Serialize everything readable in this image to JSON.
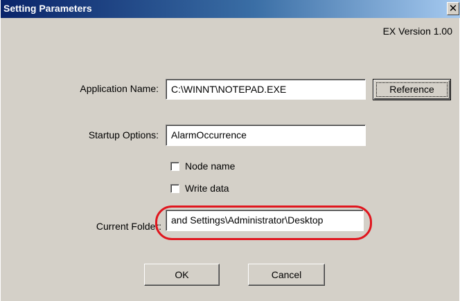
{
  "window": {
    "title": "Setting Parameters",
    "close_glyph": "✕",
    "version": "EX Version 1.00"
  },
  "form": {
    "application_name": {
      "label": "Application Name:",
      "value": "C:\\WINNT\\NOTEPAD.EXE"
    },
    "reference_label": "Reference",
    "startup_options": {
      "label": "Startup Options:",
      "value": "AlarmOccurrence"
    },
    "node_name": {
      "label": "Node name",
      "checked": false
    },
    "write_data": {
      "label": "Write data",
      "checked": false
    },
    "current_folder": {
      "label": "Current Folder:",
      "value": "and Settings\\Administrator\\Desktop"
    }
  },
  "buttons": {
    "ok": "OK",
    "cancel": "Cancel"
  },
  "annotation": {
    "highlight_color": "#e0161e"
  }
}
